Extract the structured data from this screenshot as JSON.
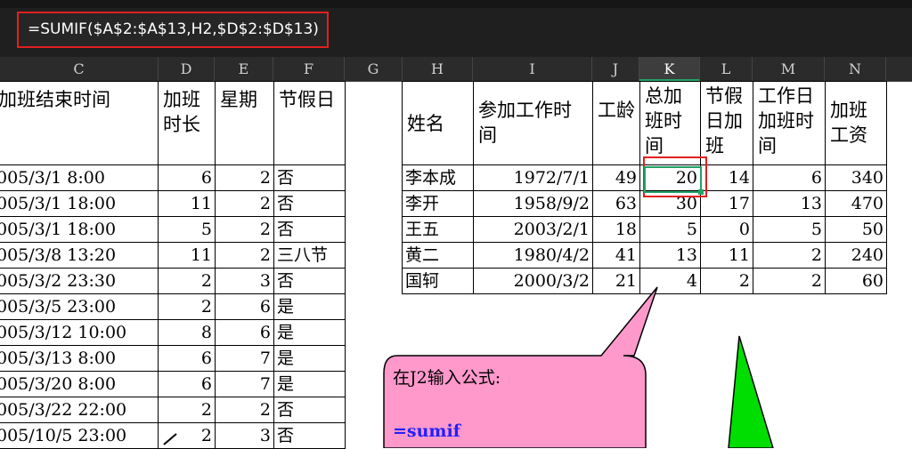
{
  "formula_bar": {
    "formula": "=SUMIF($A$2:$A$13,H2,$D$2:$D$13)"
  },
  "column_headers": [
    "C",
    "D",
    "E",
    "F",
    "G",
    "H",
    "I",
    "J",
    "K",
    "L",
    "M",
    "N"
  ],
  "selected_column": "K",
  "left_table": {
    "headers": {
      "end_time": "加班结束时间",
      "duration": "加班时长",
      "weekday": "星期",
      "holiday": "节假日"
    },
    "rows": [
      {
        "end_time": "005/3/1 8:00",
        "duration": "6",
        "weekday": "2",
        "holiday": "否"
      },
      {
        "end_time": "005/3/1 18:00",
        "duration": "11",
        "weekday": "2",
        "holiday": "否"
      },
      {
        "end_time": "005/3/1 18:00",
        "duration": "5",
        "weekday": "2",
        "holiday": "否"
      },
      {
        "end_time": "005/3/8 13:20",
        "duration": "11",
        "weekday": "2",
        "holiday": "三八节"
      },
      {
        "end_time": "005/3/2 23:30",
        "duration": "2",
        "weekday": "3",
        "holiday": "否"
      },
      {
        "end_time": "005/3/5 23:00",
        "duration": "2",
        "weekday": "6",
        "holiday": "是"
      },
      {
        "end_time": "005/3/12 10:00",
        "duration": "8",
        "weekday": "6",
        "holiday": "是"
      },
      {
        "end_time": "005/3/13 8:00",
        "duration": "6",
        "weekday": "7",
        "holiday": "是"
      },
      {
        "end_time": "005/3/20 8:00",
        "duration": "6",
        "weekday": "7",
        "holiday": "是"
      },
      {
        "end_time": "005/3/22 22:00",
        "duration": "2",
        "weekday": "2",
        "holiday": "否"
      },
      {
        "end_time": "005/10/5 23:00",
        "duration": "2",
        "weekday": "3",
        "holiday": "否"
      }
    ]
  },
  "right_table": {
    "headers": {
      "name": "姓名",
      "start_date": "参加工作时间",
      "seniority": "工龄",
      "total_ot": "总加班时间",
      "holiday_ot": "节假日加班",
      "workday_ot": "工作日加班时间",
      "ot_pay": "加班工资"
    },
    "rows": [
      {
        "name": "李本成",
        "start_date": "1972/7/1",
        "seniority": "49",
        "total_ot": "20",
        "holiday_ot": "14",
        "workday_ot": "6",
        "ot_pay": "340"
      },
      {
        "name": "李开",
        "start_date": "1958/9/2",
        "seniority": "63",
        "total_ot": "30",
        "holiday_ot": "17",
        "workday_ot": "13",
        "ot_pay": "470"
      },
      {
        "name": "王五",
        "start_date": "2003/2/1",
        "seniority": "18",
        "total_ot": "5",
        "holiday_ot": "0",
        "workday_ot": "5",
        "ot_pay": "50"
      },
      {
        "name": "黄二",
        "start_date": "1980/4/2",
        "seniority": "41",
        "total_ot": "13",
        "holiday_ot": "11",
        "workday_ot": "2",
        "ot_pay": "240"
      },
      {
        "name": "国轲",
        "start_date": "2000/3/2",
        "seniority": "21",
        "total_ot": "4",
        "holiday_ot": "2",
        "workday_ot": "2",
        "ot_pay": "60"
      }
    ]
  },
  "callout": {
    "line1": "在J2输入公式:",
    "line2": "=sumif",
    "fill_color": "#ff99cc"
  },
  "arrow_color": "#00dd00"
}
